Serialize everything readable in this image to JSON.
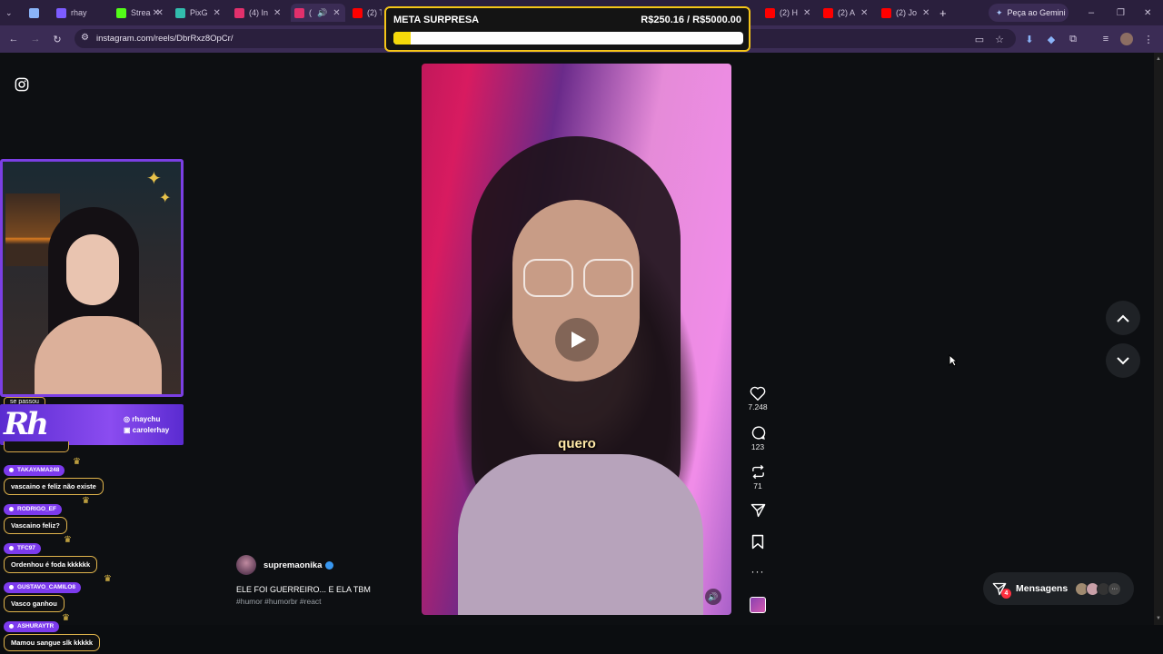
{
  "browser": {
    "tabs": [
      {
        "title": "",
        "color": "#8ab4f8"
      },
      {
        "title": "rhay",
        "color": "#7c5cff"
      },
      {
        "title": "Strea",
        "color": "#53fc18"
      },
      {
        "title": "PixG",
        "color": "#32bcad"
      },
      {
        "title": "(4) In",
        "color": "#e1306c"
      },
      {
        "title": "(",
        "color": "#e1306c"
      },
      {
        "title": "(2) T",
        "color": "#ff0000"
      },
      {
        "title": "(2) H",
        "color": "#ff0000"
      },
      {
        "title": "(2) A",
        "color": "#ff0000"
      },
      {
        "title": "(2) Jo",
        "color": "#ff0000"
      }
    ],
    "new_tab": "+",
    "gemini_label": "Peça ao Gemini",
    "url": "instagram.com/reels/DbrRxz8OpCr/"
  },
  "meta": {
    "label": "META SURPRESA",
    "amount": "R$250.16 / R$5000.00",
    "progress": 0.05,
    "accent": "#f5c518"
  },
  "reel": {
    "subtitle": "quero",
    "likes": "7.248",
    "comments": "123",
    "reposts": "71",
    "author": "supremaonika",
    "caption": "ELE FOI GUERREIRO... E ELA TBM",
    "tags": "#humor #humorbr #react"
  },
  "messages": {
    "label": "Mensagens",
    "badge": "4"
  },
  "overlay": {
    "top_pill": "se passou",
    "handles": [
      "rhaychu",
      "carolerhay"
    ],
    "logo": "Rh",
    "chat": [
      {
        "user": "TAKAYAMA248",
        "text": "vascaino e feliz não existe"
      },
      {
        "user": "RODRIGO_EF",
        "text": "Vascaino feliz?"
      },
      {
        "user": "TFC97",
        "text": "Ordenhou é foda kkkkkk"
      },
      {
        "user": "GUSTAVO_CAMILO8",
        "text": "Vasco ganhou"
      },
      {
        "user": "ASHURAYTR",
        "text": "Mamou sangue slk kkkkk"
      }
    ]
  }
}
